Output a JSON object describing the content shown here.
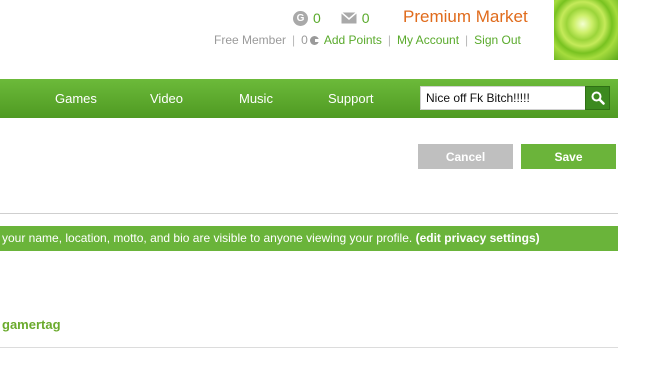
{
  "header": {
    "gamerscore_icon": "G",
    "gamerscore": "0",
    "messages": "0",
    "premium_market": "Premium Market",
    "membership": "Free Member",
    "points": "0",
    "add_points": "Add Points",
    "my_account": "My Account",
    "sign_out": "Sign Out",
    "icons": [
      "gamerscore-icon",
      "mail-icon",
      "points-coin-icon"
    ]
  },
  "nav": {
    "items": [
      "Games",
      "Video",
      "Music",
      "Support"
    ],
    "search_value": "Nice off Fk Bitch!!!!!",
    "search_icon": "search-icon"
  },
  "buttons": {
    "cancel": "Cancel",
    "save": "Save"
  },
  "privacy_banner": {
    "text": "your name, location, motto, and bio are visible to anyone viewing your profile.",
    "link": "(edit privacy settings)"
  },
  "section": {
    "title": "gamertag"
  },
  "colors": {
    "brand_green": "#5aaa2c",
    "nav_green": "#5fa92e",
    "premium_orange": "#e06b1c",
    "cancel_gray": "#bfbfbf"
  }
}
